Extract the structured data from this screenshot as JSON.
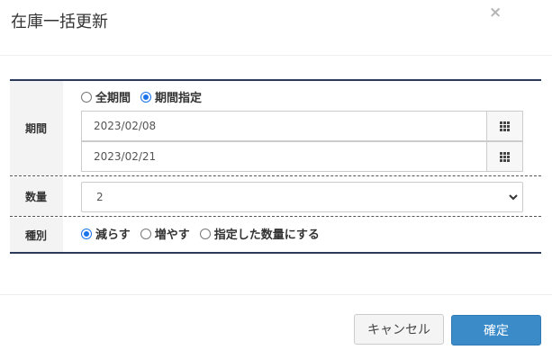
{
  "modal": {
    "title": "在庫一括更新",
    "close_label": "×"
  },
  "form": {
    "period": {
      "label": "期間",
      "options": [
        {
          "label": "全期間",
          "checked": false
        },
        {
          "label": "期間指定",
          "checked": true
        }
      ],
      "start_date": "2023/02/08",
      "end_date": "2023/02/21",
      "calendar_icon": "calendar-grid-icon"
    },
    "quantity": {
      "label": "数量",
      "value": "2",
      "chevron_icon": "chevron-down-icon"
    },
    "type": {
      "label": "種別",
      "options": [
        {
          "label": "減らす",
          "checked": true
        },
        {
          "label": "増やす",
          "checked": false
        },
        {
          "label": "指定した数量にする",
          "checked": false
        }
      ]
    }
  },
  "footer": {
    "cancel_label": "キャンセル",
    "ok_label": "確定"
  },
  "colors": {
    "accent": "#3b8bc9",
    "table_border": "#2b3a5a",
    "radio_checked": "#1a73e8"
  }
}
